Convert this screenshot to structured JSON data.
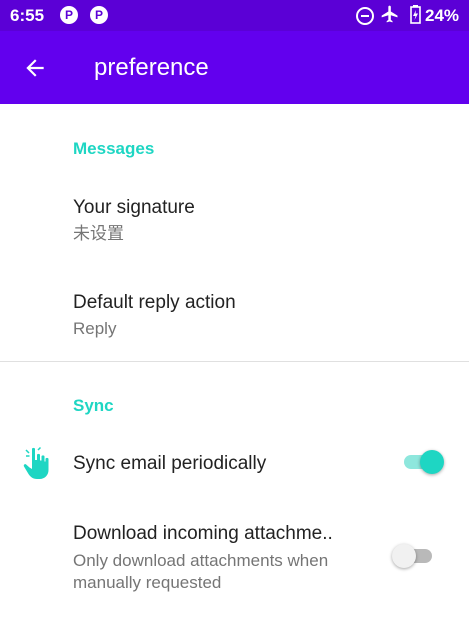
{
  "status_bar": {
    "time": "6:55",
    "app_icons": [
      "P",
      "P"
    ],
    "battery": "24%"
  },
  "app_bar": {
    "title": "preference"
  },
  "sections": {
    "messages": {
      "header": "Messages",
      "signature": {
        "title": "Your signature",
        "summary": "未设置"
      },
      "reply": {
        "title": "Default reply action",
        "summary": "Reply"
      }
    },
    "sync": {
      "header": "Sync",
      "sync_email": {
        "title": "Sync email periodically",
        "enabled": true
      },
      "attachments": {
        "title": "Download incoming attachme..",
        "summary_line1": "Only download attachments when",
        "summary_line2": "manually requested",
        "enabled": false
      }
    }
  },
  "colors": {
    "status_bar": "#5b00d6",
    "app_bar": "#6200ee",
    "accent": "#1ed6c3"
  }
}
